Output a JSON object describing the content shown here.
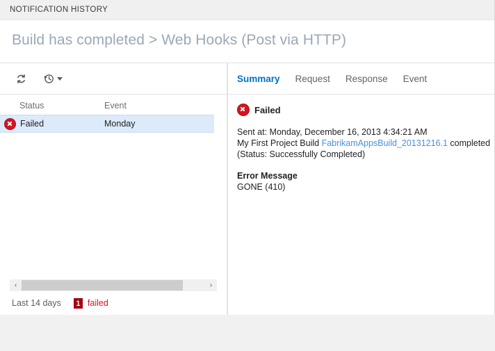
{
  "window": {
    "titlebar": "NOTIFICATION HISTORY"
  },
  "header": {
    "breadcrumb": "Build has completed > Web Hooks (Post via HTTP)"
  },
  "toolbar": {
    "refresh_icon": "refresh-icon",
    "history_icon": "history-clock-icon",
    "history_caret": "chevron-down-icon"
  },
  "list": {
    "columns": [
      "Status",
      "Event"
    ],
    "rows": [
      {
        "status": "Failed",
        "event": "Monday",
        "icon": "error-icon",
        "selected": true
      }
    ],
    "scroll_left_icon": "‹",
    "scroll_right_icon": "›"
  },
  "statusbar": {
    "range_label": "Last 14 days",
    "failed_count": "1",
    "failed_label": "failed",
    "badge_color": "#a4000f",
    "failed_text_color": "#d81320"
  },
  "details": {
    "tabs": [
      {
        "label": "Summary",
        "active": true
      },
      {
        "label": "Request",
        "active": false
      },
      {
        "label": "Response",
        "active": false
      },
      {
        "label": "Event",
        "active": false
      }
    ],
    "status_icon": "error-icon",
    "status_label": "Failed",
    "sent_at": "Sent at: Monday, December 16, 2013 4:34:21 AM",
    "body_prefix": "My First Project Build ",
    "body_link": "FabrikamAppsBuild_20131216.1",
    "body_suffix": " completed (Status: Successfully Completed)",
    "error_title": "Error Message",
    "error_value": "GONE (410)",
    "link_color": "#4a90d9",
    "accent_color": "#0072c6"
  }
}
